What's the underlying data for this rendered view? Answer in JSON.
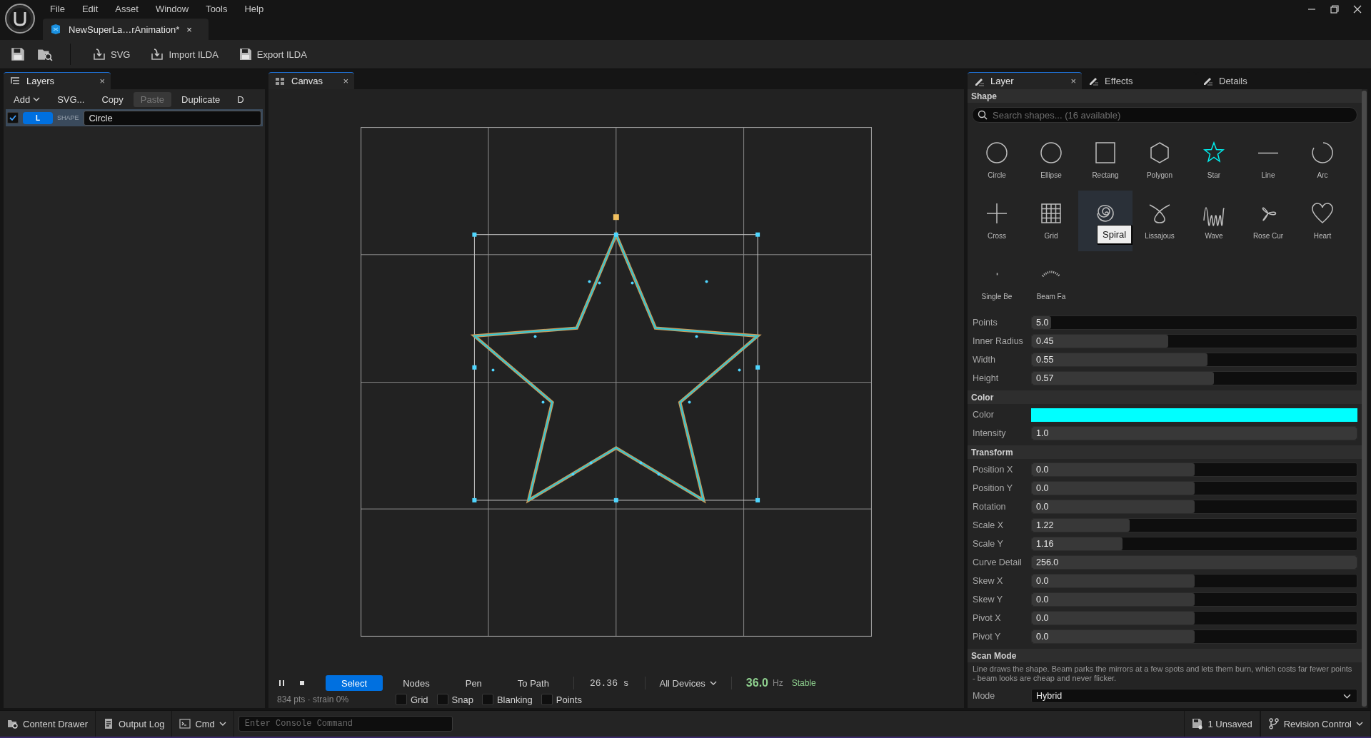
{
  "menu": [
    "File",
    "Edit",
    "Asset",
    "Window",
    "Tools",
    "Help"
  ],
  "document_tab": {
    "title": "NewSuperLa…rAnimation*",
    "close": "×"
  },
  "toolbar": [
    {
      "label": "SVG"
    },
    {
      "label": "Import ILDA"
    },
    {
      "label": "Export ILDA"
    }
  ],
  "layers_panel": {
    "tab": "Layers",
    "close": "×",
    "actions": [
      {
        "label": "Add",
        "dropdown": true,
        "disabled": false
      },
      {
        "label": "SVG...",
        "dropdown": false,
        "disabled": false
      },
      {
        "label": "Copy",
        "dropdown": false,
        "disabled": false
      },
      {
        "label": "Paste",
        "dropdown": false,
        "disabled": true
      },
      {
        "label": "Duplicate",
        "dropdown": false,
        "disabled": false
      },
      {
        "label": "D",
        "dropdown": false,
        "disabled": false
      }
    ],
    "layers": [
      {
        "checked": true,
        "badge": "L",
        "type": "SHAPE",
        "name": "Circle",
        "selected": true
      }
    ]
  },
  "canvas_panel": {
    "tab": "Canvas",
    "close": "×",
    "tools": [
      {
        "label": "Select",
        "selected": true
      },
      {
        "label": "Nodes",
        "selected": false
      },
      {
        "label": "Pen",
        "selected": false
      },
      {
        "label": "To Path",
        "selected": false
      }
    ],
    "time": "26.36 s",
    "device": "All Devices",
    "rate": "36.0",
    "rate_unit": "Hz",
    "status": "Stable",
    "stats": "834 pts · strain 0%",
    "toggles": [
      {
        "label": "Grid",
        "checked": false
      },
      {
        "label": "Snap",
        "checked": false
      },
      {
        "label": "Blanking",
        "checked": false
      },
      {
        "label": "Points",
        "checked": false
      }
    ]
  },
  "right_panel": {
    "tabs": [
      {
        "label": "Layer",
        "selected": true,
        "close": "×"
      },
      {
        "label": "Effects",
        "selected": false
      },
      {
        "label": "Details",
        "selected": false
      }
    ],
    "sections": [
      {
        "title": "Shape",
        "search_placeholder": "Search shapes... (16 available)",
        "tooltip": "Spiral",
        "shapes": [
          {
            "label": "Circle",
            "selected": false,
            "hovered": false
          },
          {
            "label": "Ellipse",
            "selected": false,
            "hovered": false
          },
          {
            "label": "Rectang",
            "selected": false,
            "hovered": false
          },
          {
            "label": "Polygon",
            "selected": false,
            "hovered": false
          },
          {
            "label": "Star",
            "selected": true,
            "hovered": false
          },
          {
            "label": "Line",
            "selected": false,
            "hovered": false
          },
          {
            "label": "Arc",
            "selected": false,
            "hovered": false
          },
          {
            "label": "Cross",
            "selected": false,
            "hovered": false
          },
          {
            "label": "Grid",
            "selected": false,
            "hovered": false
          },
          {
            "selected": false,
            "hovered": true
          },
          {
            "label": "Lissajous",
            "selected": false,
            "hovered": false
          },
          {
            "label": "Wave",
            "selected": false,
            "hovered": false
          },
          {
            "label": "Rose Cur",
            "selected": false,
            "hovered": false
          },
          {
            "label": "Heart",
            "selected": false,
            "hovered": false
          },
          {
            "label": "Single Be",
            "selected": false,
            "hovered": false
          },
          {
            "label": "Beam Fa",
            "selected": false,
            "hovered": false
          }
        ],
        "rows": [
          {
            "kind": "slider",
            "label": "Points",
            "value": "5.0",
            "level": 0.06
          },
          {
            "kind": "slider",
            "label": "Inner Radius",
            "value": "0.45",
            "level": 0.42
          },
          {
            "kind": "slider",
            "label": "Width",
            "value": "0.55",
            "level": 0.54
          },
          {
            "kind": "slider",
            "label": "Height",
            "value": "0.57",
            "level": 0.56
          }
        ]
      },
      {
        "title": "Color",
        "rows": [
          {
            "kind": "color",
            "label": "Color",
            "color": "#00ffff"
          },
          {
            "kind": "slider",
            "label": "Intensity",
            "value": "1.0",
            "level": 1
          }
        ]
      },
      {
        "title": "Transform",
        "rows": [
          {
            "kind": "slider",
            "label": "Position X",
            "value": "0.0",
            "level": 0.5
          },
          {
            "kind": "slider",
            "label": "Position Y",
            "value": "0.0",
            "level": 0.5
          },
          {
            "kind": "slider",
            "label": "Rotation",
            "value": "0.0",
            "level": 0.5
          },
          {
            "kind": "slider",
            "label": "Scale X",
            "value": "1.22",
            "level": 0.3
          },
          {
            "kind": "slider",
            "label": "Scale Y",
            "value": "1.16",
            "level": 0.28
          },
          {
            "kind": "slider",
            "label": "Curve Detail",
            "value": "256.0",
            "level": 1
          },
          {
            "kind": "slider",
            "label": "Skew X",
            "value": "0.0",
            "level": 0.5
          },
          {
            "kind": "slider",
            "label": "Skew Y",
            "value": "0.0",
            "level": 0.5
          },
          {
            "kind": "slider",
            "label": "Pivot X",
            "value": "0.0",
            "level": 0.5
          },
          {
            "kind": "slider",
            "label": "Pivot Y",
            "value": "0.0",
            "level": 0.5
          }
        ]
      },
      {
        "title": "Scan Mode",
        "description": "Line draws the shape. Beam parks the mirrors at a few spots and lets them burn, which costs far fewer points - beam looks are cheap and never flicker.",
        "rows": [
          {
            "kind": "dropdown",
            "label": "Mode",
            "value": "Hybrid"
          }
        ]
      }
    ]
  },
  "status_bar": {
    "content_drawer": "Content Drawer",
    "output_log": "Output Log",
    "cmd": "Cmd",
    "console_placeholder": "Enter Console Command",
    "unsaved": "1 Unsaved",
    "revision": "Revision Control"
  }
}
